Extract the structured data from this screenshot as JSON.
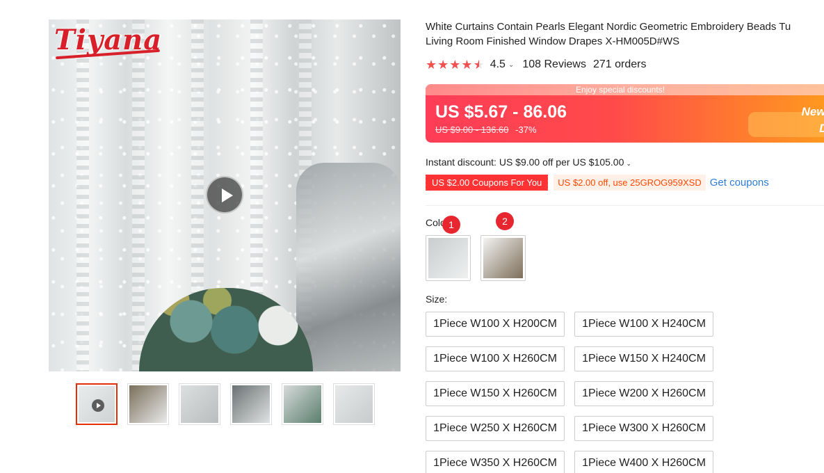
{
  "gallery": {
    "logo_text": "Tiyana",
    "thumbnails": [
      {
        "name": "thumb-1",
        "has_video": true,
        "active": true,
        "colors": [
          "#e8ecec",
          "#cfd3d3"
        ]
      },
      {
        "name": "thumb-2",
        "has_video": false,
        "active": false,
        "colors": [
          "#7a6f5a",
          "#e9eaea"
        ]
      },
      {
        "name": "thumb-3",
        "has_video": false,
        "active": false,
        "colors": [
          "#dcdfe0",
          "#b9bdbe"
        ]
      },
      {
        "name": "thumb-4",
        "has_video": false,
        "active": false,
        "colors": [
          "#6c7274",
          "#dfe2e2"
        ]
      },
      {
        "name": "thumb-5",
        "has_video": false,
        "active": false,
        "colors": [
          "#d6dada",
          "#5b7f6e"
        ]
      },
      {
        "name": "thumb-6",
        "has_video": false,
        "active": false,
        "colors": [
          "#e7e9e9",
          "#c7cbcc"
        ]
      }
    ]
  },
  "product": {
    "title_line1": "White Curtains Contain Pearls Elegant Nordic Geometric Embroidery Beads Tu",
    "title_line2": "Living Room Finished Window Drapes X-HM005D#WS",
    "rating": "4.5",
    "rating_stars": 4.5,
    "reviews": "108 Reviews",
    "orders": "271 orders"
  },
  "price": {
    "banner_top": "Enjoy special discounts!",
    "current": "US $5.67 - 86.06",
    "original": "US $9.00 - 136.60",
    "discount": "-37%",
    "deal_line1": "New Us",
    "deal_line2": "Deal"
  },
  "instant_discount": "Instant discount: US $9.00 off per US $105.00",
  "coupons": {
    "tag": "US $2.00 Coupons For You",
    "code": "US $2.00 off, use 25GROG959XSD",
    "link": "Get coupons"
  },
  "color": {
    "label": "Color:",
    "options": [
      {
        "badge": "1",
        "colors": [
          "#c9cdce",
          "#eef0f0"
        ]
      },
      {
        "badge": "2",
        "colors": [
          "#f3f3f1",
          "#7d6e59"
        ]
      }
    ]
  },
  "size": {
    "label": "Size:",
    "options": [
      "1Piece W100 X H200CM",
      "1Piece W100 X H240CM",
      "1Piece W100 X H260CM",
      "1Piece W150 X H240CM",
      "1Piece W150 X H260CM",
      "1Piece W200 X H260CM",
      "1Piece W250 X H260CM",
      "1Piece W300 X H260CM",
      "1Piece W350 X H260CM",
      "1Piece W400 X H260CM"
    ]
  },
  "colors": {
    "accent_red": "#e62e04",
    "star": "#f24f4f",
    "link_blue": "#2e7bd6"
  }
}
